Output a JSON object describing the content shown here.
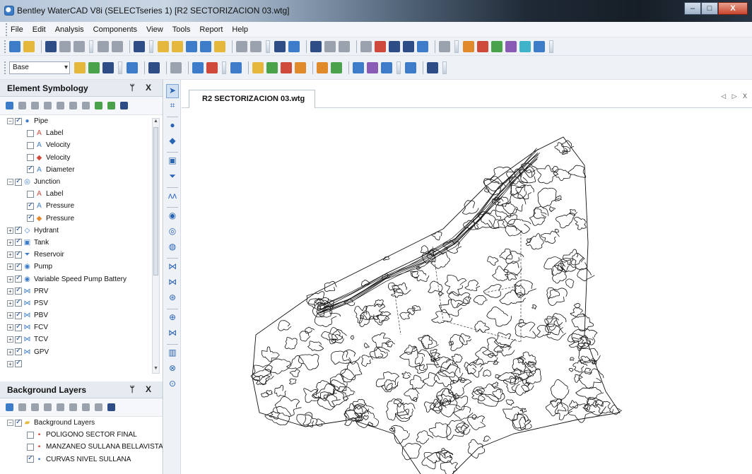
{
  "window": {
    "title": "Bentley WaterCAD V8i (SELECTseries 1) [R2 SECTORIZACION 03.wtg]",
    "controls": {
      "minimize": "–",
      "maximize": "□",
      "close": "X"
    }
  },
  "menu": [
    "File",
    "Edit",
    "Analysis",
    "Components",
    "View",
    "Tools",
    "Report",
    "Help"
  ],
  "toolbar": {
    "scenario_combo": "Base"
  },
  "element_symbology": {
    "title": "Element Symbology",
    "header_buttons": "ᛘ X",
    "items": [
      {
        "label": "Pipe",
        "level": 0,
        "expanded": true,
        "checked": true,
        "symbol": "●",
        "symbol_color": "#3d7cc9"
      },
      {
        "label": "Label",
        "level": 1,
        "checked": false,
        "symbol": "A",
        "symbol_color": "#cf4a3a"
      },
      {
        "label": "Velocity",
        "level": 1,
        "checked": false,
        "symbol": "A",
        "symbol_color": "#3d7cc9"
      },
      {
        "label": "Velocity",
        "level": 1,
        "checked": false,
        "symbol": "◆",
        "symbol_color": "#cf4a3a"
      },
      {
        "label": "Diameter",
        "level": 1,
        "checked": true,
        "symbol": "A",
        "symbol_color": "#3d7cc9"
      },
      {
        "label": "Junction",
        "level": 0,
        "expanded": true,
        "checked": true,
        "symbol": "◎",
        "symbol_color": "#3d7cc9"
      },
      {
        "label": "Label",
        "level": 1,
        "checked": false,
        "symbol": "A",
        "symbol_color": "#cf4a3a"
      },
      {
        "label": "Pressure",
        "level": 1,
        "checked": true,
        "symbol": "A",
        "symbol_color": "#3d7cc9"
      },
      {
        "label": "Pressure",
        "level": 1,
        "checked": true,
        "symbol": "◆",
        "symbol_color": "#e08a2c"
      },
      {
        "label": "Hydrant",
        "level": 0,
        "expanded": false,
        "checked": true,
        "symbol": "◇",
        "symbol_color": "#3d7cc9"
      },
      {
        "label": "Tank",
        "level": 0,
        "expanded": false,
        "checked": true,
        "symbol": "▣",
        "symbol_color": "#3d7cc9"
      },
      {
        "label": "Reservoir",
        "level": 0,
        "expanded": false,
        "checked": true,
        "symbol": "⏷",
        "symbol_color": "#3d7cc9"
      },
      {
        "label": "Pump",
        "level": 0,
        "expanded": false,
        "checked": true,
        "symbol": "◉",
        "symbol_color": "#3d7cc9"
      },
      {
        "label": "Variable Speed Pump Battery",
        "level": 0,
        "expanded": false,
        "checked": true,
        "symbol": "◉",
        "symbol_color": "#3d7cc9"
      },
      {
        "label": "PRV",
        "level": 0,
        "expanded": false,
        "checked": true,
        "symbol": "⋈",
        "symbol_color": "#3d7cc9"
      },
      {
        "label": "PSV",
        "level": 0,
        "expanded": false,
        "checked": true,
        "symbol": "⋈",
        "symbol_color": "#3d7cc9"
      },
      {
        "label": "PBV",
        "level": 0,
        "expanded": false,
        "checked": true,
        "symbol": "⋈",
        "symbol_color": "#3d7cc9"
      },
      {
        "label": "FCV",
        "level": 0,
        "expanded": false,
        "checked": true,
        "symbol": "⋈",
        "symbol_color": "#3d7cc9"
      },
      {
        "label": "TCV",
        "level": 0,
        "expanded": false,
        "checked": true,
        "symbol": "⋈",
        "symbol_color": "#3d7cc9"
      },
      {
        "label": "GPV",
        "level": 0,
        "expanded": false,
        "checked": true,
        "symbol": "⋈",
        "symbol_color": "#3d7cc9"
      },
      {
        "label": "",
        "level": 0,
        "expanded": false,
        "checked": true,
        "symbol": "",
        "symbol_color": "#3d7cc9"
      }
    ]
  },
  "background_layers": {
    "title": "Background Layers",
    "header_buttons": "ᛘ X",
    "items": [
      {
        "label": "Background Layers",
        "level": 0,
        "expanded": true,
        "checked": true,
        "symbol": "▰",
        "symbol_color": "#e5b73a"
      },
      {
        "label": "POLIGONO SECTOR FINAL",
        "level": 1,
        "checked": false,
        "symbol": "▪",
        "symbol_color": "#cf4a3a"
      },
      {
        "label": "MANZANEO SULLANA BELLAVISTA",
        "level": 1,
        "checked": false,
        "symbol": "▪",
        "symbol_color": "#cf4a3a"
      },
      {
        "label": "CURVAS NIVEL SULLANA",
        "level": 1,
        "checked": true,
        "symbol": "▪",
        "symbol_color": "#3d7cc9"
      }
    ]
  },
  "document": {
    "tab": "R2 SECTORIZACION 03.wtg",
    "tab_nav": "◁ ▷ X"
  },
  "colors": {
    "accent": "#3d7cc9",
    "panel_header": "#e6ebf1",
    "contour": "#111111"
  }
}
